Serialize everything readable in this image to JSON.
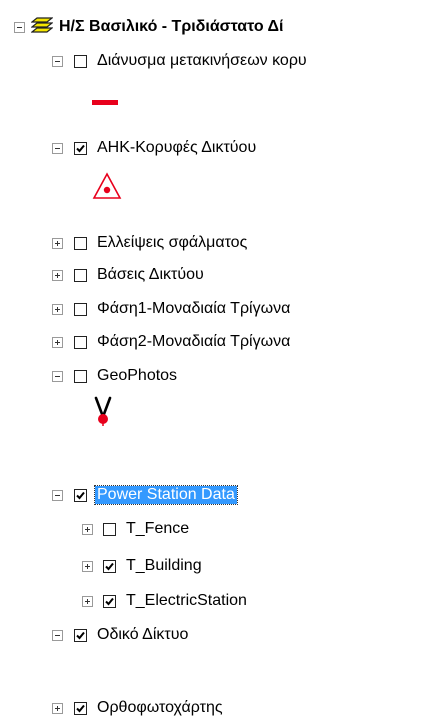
{
  "toc": {
    "root": {
      "label": "Η/Σ Βασιλικό - Τριδιάστατο Δί",
      "icon": "layers-group-icon"
    },
    "layers": [
      {
        "label": "Διάνυσμα μετακινήσεων κορυ",
        "checked": false,
        "expanded": true,
        "symbol": "red-line-icon"
      },
      {
        "label": "ΑΗΚ-Κορυφές Δικτύου",
        "checked": true,
        "expanded": true,
        "symbol": "triangle-point-icon"
      },
      {
        "label": "Ελλείψεις σφάλματος",
        "checked": false,
        "expanded": false
      },
      {
        "label": "Βάσεις Δικτύου",
        "checked": false,
        "expanded": false
      },
      {
        "label": "Φάση1-Μοναδιαία Τρίγωνα",
        "checked": false,
        "expanded": false
      },
      {
        "label": "Φάση2-Μοναδιαία Τρίγωνα",
        "checked": false,
        "expanded": false
      },
      {
        "label": "GeoPhotos",
        "checked": false,
        "expanded": true,
        "symbol": "geophoto-marker-icon"
      },
      {
        "label": "Power Station Data",
        "checked": true,
        "expanded": true,
        "selected": true
      },
      {
        "label": "T_Fence",
        "checked": false,
        "expanded": false
      },
      {
        "label": "T_Building",
        "checked": true,
        "expanded": false
      },
      {
        "label": "T_ElectricStation",
        "checked": true,
        "expanded": false
      },
      {
        "label": "Οδικό Δίκτυο",
        "checked": true,
        "expanded": true
      },
      {
        "label": "Ορθοφωτοχάρτης",
        "checked": true,
        "expanded": false
      }
    ],
    "colors": {
      "selection": "#3399ff",
      "symbol_red": "#e8001c",
      "group_icon_yellow": "#f5e600"
    }
  }
}
